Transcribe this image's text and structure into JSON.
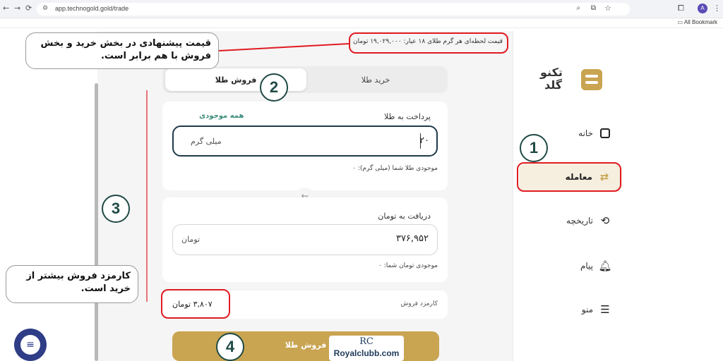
{
  "browser": {
    "url": "app.technogold.gold/trade",
    "bookmarks_label": "All Bookmark"
  },
  "sidebar": {
    "logo_line1": "تکنو",
    "logo_line2": "گلد",
    "items": [
      {
        "label": "خانه",
        "icon": "home-icon"
      },
      {
        "label": "معامله",
        "icon": "trade-icon",
        "active": true
      },
      {
        "label": "تاریخچه",
        "icon": "history-icon"
      },
      {
        "label": "پیام",
        "icon": "bell-icon"
      },
      {
        "label": "منو",
        "icon": "menu-icon"
      }
    ]
  },
  "header": {
    "price_text": "قیمت لحظه‌ای هر گرم طلای ۱۸ عیار: ۱۹,۰۲۹,۰۰۰ تومان"
  },
  "tabs": {
    "buy": "خرید طلا",
    "sell": "فروش طلا"
  },
  "pay": {
    "label": "پرداخت به طلا",
    "all_label": "همه موجودی",
    "value": "۲۰",
    "unit": "میلی گرم",
    "balance": "موجودی طلا شما (میلی گرم): ۰"
  },
  "receive": {
    "label": "دریافت به تومان",
    "value": "۳۷۶,۹۵۲",
    "unit": "تومان",
    "balance": "موجودی تومان شما: ۰"
  },
  "fee": {
    "label": "کارمزد فروش",
    "value": "۳,۸۰۷ تومان"
  },
  "submit_label": "فروش طلا",
  "annotations": {
    "callout_top": "قیمت پیشنهادی در بخش خرید و بخش فروش با هم برابر است.",
    "callout_fee": "کارمزد فروش بیشتر از خرید است.",
    "num1": "1",
    "num2": "2",
    "num3": "3",
    "num4": "4"
  },
  "watermark": {
    "mark": "RC",
    "text": "Royalclubb.com"
  },
  "colors": {
    "accent_gold": "#c9a451",
    "active_bg": "#f6efdf",
    "annotation_red": "#e01b22",
    "circle_green": "#1f4a45"
  }
}
